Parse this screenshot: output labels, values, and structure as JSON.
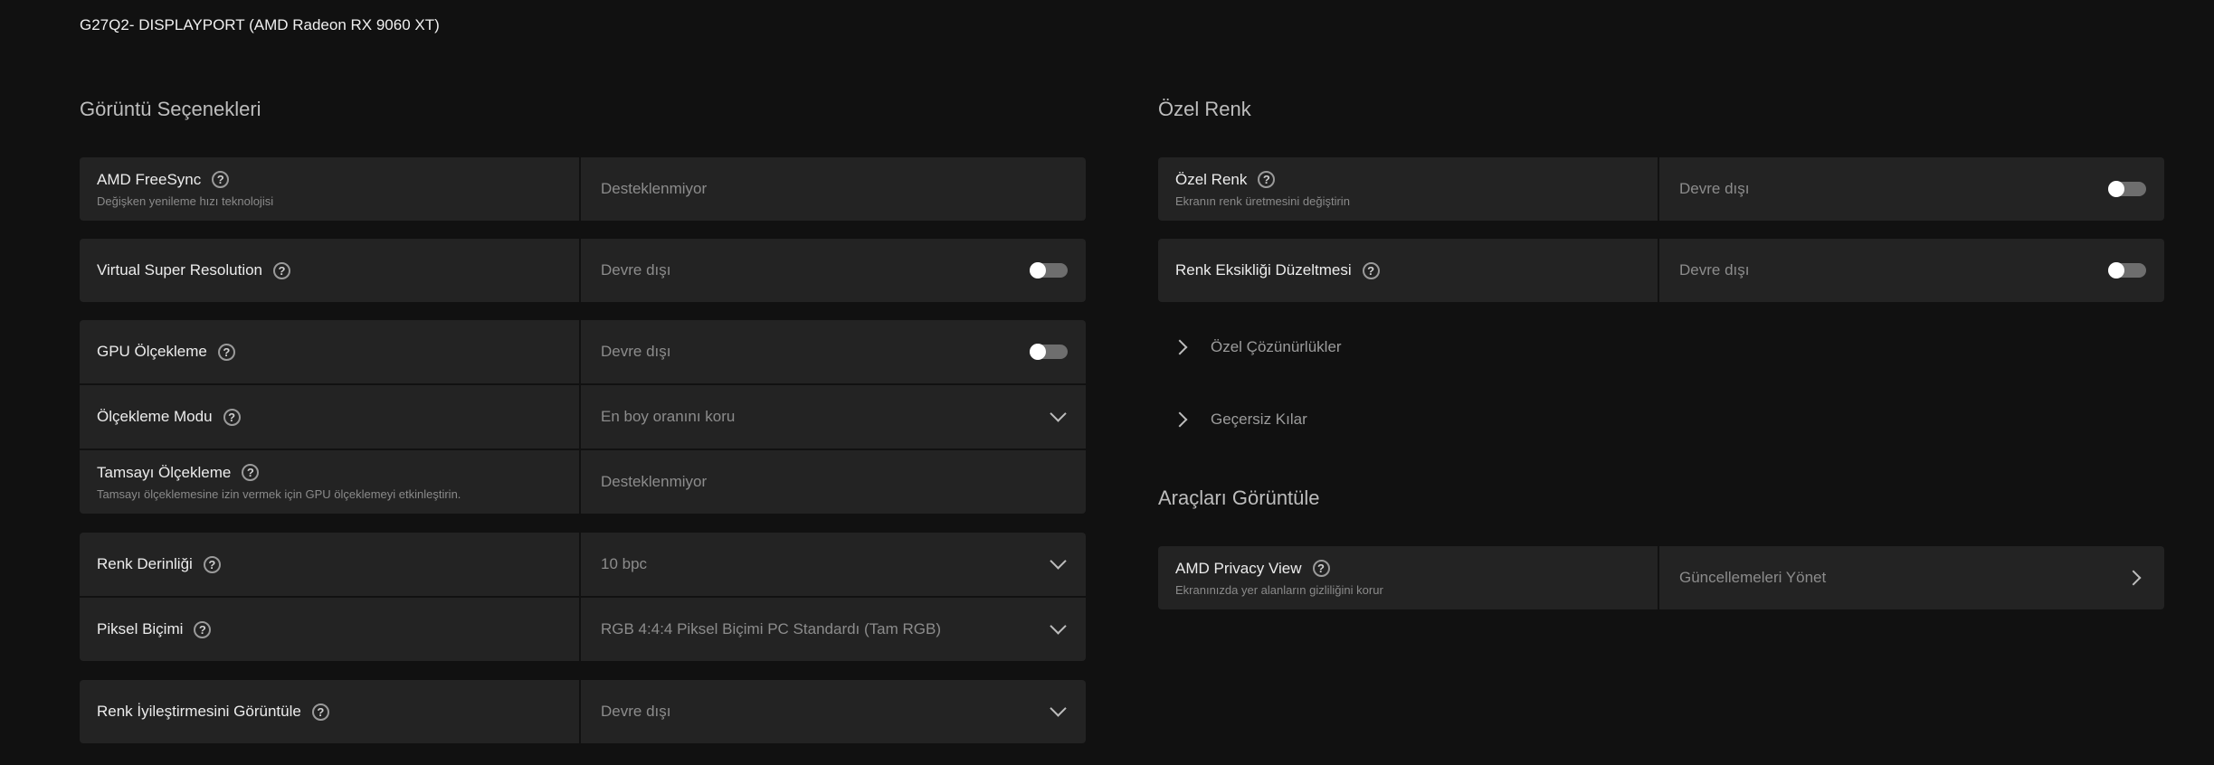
{
  "device_title": "G27Q2- DISPLAYPORT (AMD Radeon RX 9060 XT)",
  "left": {
    "section_title": "Görüntü Seçenekleri",
    "freesync": {
      "label": "AMD FreeSync",
      "sub": "Değişken yenileme hızı teknolojisi",
      "value": "Desteklenmiyor"
    },
    "vsr": {
      "label": "Virtual Super Resolution",
      "value": "Devre dışı",
      "toggle": "off"
    },
    "gpu_scaling": {
      "label": "GPU Ölçekleme",
      "value": "Devre dışı",
      "toggle": "off"
    },
    "scaling_mode": {
      "label": "Ölçekleme Modu",
      "value": "En boy oranını koru"
    },
    "integer_scaling": {
      "label": "Tamsayı Ölçekleme",
      "sub": "Tamsayı ölçeklemesine izin vermek için GPU ölçeklemeyi etkinleştirin.",
      "value": "Desteklenmiyor"
    },
    "color_depth": {
      "label": "Renk Derinliği",
      "value": "10 bpc"
    },
    "pixel_format": {
      "label": "Piksel Biçimi",
      "value": "RGB 4:4:4 Piksel Biçimi PC Standardı (Tam RGB)"
    },
    "color_enhance": {
      "label": "Renk İyileştirmesini Görüntüle",
      "value": "Devre dışı"
    }
  },
  "right": {
    "section_title": "Özel Renk",
    "custom_color": {
      "label": "Özel Renk",
      "sub": "Ekranın renk üretmesini değiştirin",
      "value": "Devre dışı",
      "toggle": "off"
    },
    "color_deficiency": {
      "label": "Renk Eksikliği Düzeltmesi",
      "value": "Devre dışı",
      "toggle": "off"
    },
    "custom_resolutions": "Özel Çözünürlükler",
    "overrides": "Geçersiz Kılar",
    "tools_title": "Araçları Görüntüle",
    "privacy_view": {
      "label": "AMD Privacy View",
      "sub": "Ekranınızda yer alanların gizliliğini korur",
      "value": "Güncellemeleri Yönet"
    }
  },
  "icons": {
    "help": "question-circle-icon",
    "dropdown": "chevron-down-icon",
    "expand": "chevron-right-icon"
  },
  "help_glyph": "?",
  "colors": {
    "background": "#111111",
    "row": "#232323",
    "toggle_off": "#6e6e6e"
  }
}
